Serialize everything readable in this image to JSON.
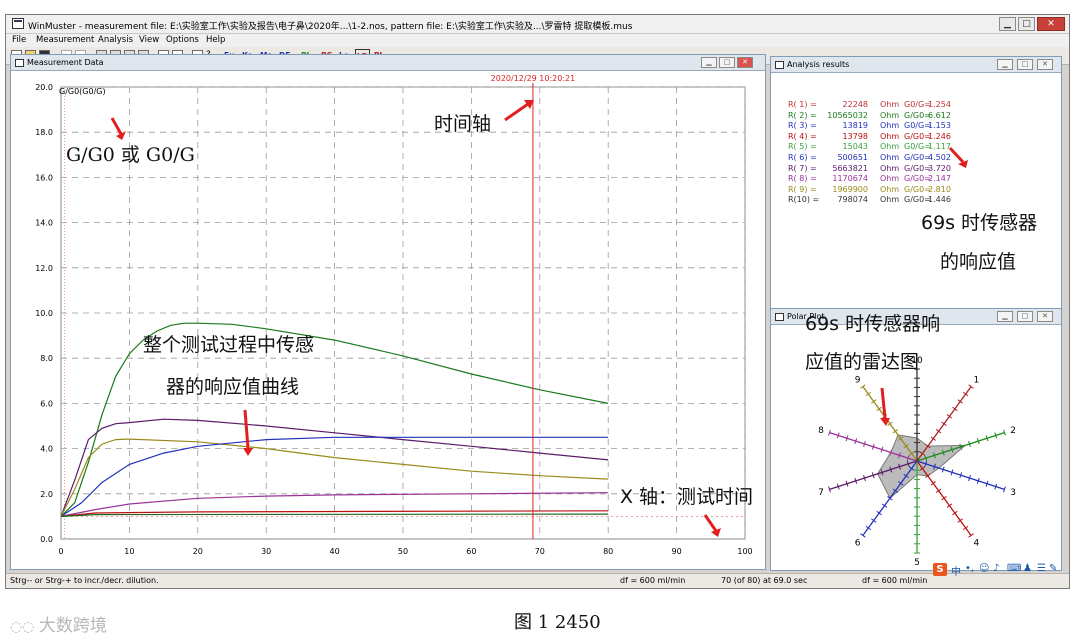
{
  "window": {
    "title": "WinMuster - measurement file: E:\\实验室工作\\实验及报告\\电子鼻\\2020年...\\1-2.nos, pattern file: E:\\实验室工作\\实验及...\\罗雷特 提取模板.mus",
    "min": "▁",
    "max": "□",
    "close": "✕"
  },
  "menu": [
    "File",
    "Measurement",
    "Analysis",
    "View",
    "Options",
    "Help"
  ],
  "toolbar": {
    "groups": [
      "Eu",
      "Ka",
      "Ma",
      "DF",
      "PL",
      "PC",
      "Lo",
      "LD",
      "PL"
    ]
  },
  "measurement": {
    "title": "Measurement Data",
    "time_marker": "2020/12/29 10:20:21",
    "legend_label": "G/G0(G0/G)"
  },
  "chart_data": {
    "type": "line",
    "title": "",
    "xlabel": "",
    "ylabel": "",
    "xlim": [
      0,
      100
    ],
    "ylim": [
      0,
      20
    ],
    "x_ticks": [
      "0",
      "10",
      "20",
      "30",
      "40",
      "50",
      "60",
      "70",
      "80",
      "90",
      "100"
    ],
    "y_ticks": [
      "0.0",
      "2.0",
      "4.0",
      "6.0",
      "8.0",
      "10.0",
      "12.0",
      "14.0",
      "16.0",
      "18.0",
      "20.0"
    ],
    "time_axis_x": 69,
    "series": [
      {
        "color": "#1a7a1a",
        "values": [
          [
            0,
            1
          ],
          [
            2,
            1.6
          ],
          [
            4,
            3.4
          ],
          [
            6,
            5.5
          ],
          [
            8,
            7.2
          ],
          [
            10,
            8.2
          ],
          [
            12,
            8.8
          ],
          [
            14,
            9.2
          ],
          [
            16,
            9.45
          ],
          [
            18,
            9.55
          ],
          [
            20,
            9.55
          ],
          [
            25,
            9.5
          ],
          [
            30,
            9.3
          ],
          [
            40,
            8.8
          ],
          [
            50,
            8.1
          ],
          [
            60,
            7.3
          ],
          [
            70,
            6.6
          ],
          [
            80,
            6.0
          ]
        ]
      },
      {
        "color": "#5a1a6a",
        "values": [
          [
            0,
            1
          ],
          [
            2,
            2.6
          ],
          [
            4,
            4.4
          ],
          [
            6,
            4.9
          ],
          [
            8,
            5.1
          ],
          [
            10,
            5.15
          ],
          [
            15,
            5.3
          ],
          [
            20,
            5.25
          ],
          [
            30,
            5.0
          ],
          [
            40,
            4.7
          ],
          [
            50,
            4.4
          ],
          [
            60,
            4.1
          ],
          [
            70,
            3.8
          ],
          [
            80,
            3.5
          ]
        ]
      },
      {
        "color": "#9a8a1a",
        "values": [
          [
            0,
            1
          ],
          [
            2,
            2.2
          ],
          [
            4,
            3.6
          ],
          [
            6,
            4.2
          ],
          [
            8,
            4.4
          ],
          [
            10,
            4.42
          ],
          [
            20,
            4.3
          ],
          [
            30,
            4.0
          ],
          [
            40,
            3.6
          ],
          [
            50,
            3.3
          ],
          [
            60,
            3.0
          ],
          [
            70,
            2.8
          ],
          [
            80,
            2.65
          ]
        ]
      },
      {
        "color": "#2233bb",
        "values": [
          [
            0,
            1
          ],
          [
            3,
            1.6
          ],
          [
            6,
            2.5
          ],
          [
            10,
            3.3
          ],
          [
            15,
            3.8
          ],
          [
            20,
            4.1
          ],
          [
            30,
            4.4
          ],
          [
            40,
            4.5
          ],
          [
            50,
            4.5
          ],
          [
            60,
            4.5
          ],
          [
            70,
            4.5
          ],
          [
            80,
            4.5
          ]
        ]
      },
      {
        "color": "#993399",
        "values": [
          [
            0,
            1
          ],
          [
            5,
            1.3
          ],
          [
            10,
            1.55
          ],
          [
            20,
            1.8
          ],
          [
            30,
            1.9
          ],
          [
            40,
            1.95
          ],
          [
            60,
            2.0
          ],
          [
            80,
            2.05
          ]
        ]
      },
      {
        "color": "#bb1111",
        "values": [
          [
            0,
            1
          ],
          [
            5,
            1.15
          ],
          [
            20,
            1.2
          ],
          [
            80,
            1.25
          ]
        ]
      },
      {
        "color": "#226622",
        "values": [
          [
            0,
            1
          ],
          [
            5,
            1.08
          ],
          [
            80,
            1.1
          ]
        ]
      }
    ]
  },
  "analysis": {
    "title": "Analysis results",
    "rows": [
      {
        "label": "R( 1) =",
        "ohm": "22248",
        "unit": "Ohm",
        "ratio": "G0/G=",
        "val": "1.254",
        "color": "#c03030"
      },
      {
        "label": "R( 2) =",
        "ohm": "10565032",
        "unit": "Ohm",
        "ratio": "G/G0=",
        "val": "6.612",
        "color": "#1a7a1a"
      },
      {
        "label": "R( 3) =",
        "ohm": "13819",
        "unit": "Ohm",
        "ratio": "G0/G=",
        "val": "1.153",
        "color": "#2233bb"
      },
      {
        "label": "R( 4) =",
        "ohm": "13798",
        "unit": "Ohm",
        "ratio": "G/G0=",
        "val": "1.246",
        "color": "#bb1111"
      },
      {
        "label": "R( 5) =",
        "ohm": "15043",
        "unit": "Ohm",
        "ratio": "G0/G=",
        "val": "1.117",
        "color": "#3aa03a"
      },
      {
        "label": "R( 6) =",
        "ohm": "500651",
        "unit": "Ohm",
        "ratio": "G/G0=",
        "val": "4.502",
        "color": "#2233bb"
      },
      {
        "label": "R( 7) =",
        "ohm": "5663821",
        "unit": "Ohm",
        "ratio": "G/G0=",
        "val": "3.720",
        "color": "#5a1a6a"
      },
      {
        "label": "R( 8) =",
        "ohm": "1170674",
        "unit": "Ohm",
        "ratio": "G/G0=",
        "val": "2.147",
        "color": "#993399"
      },
      {
        "label": "R( 9) =",
        "ohm": "1969900",
        "unit": "Ohm",
        "ratio": "G/G0=",
        "val": "2.810",
        "color": "#9a8a1a"
      },
      {
        "label": "R(10) =",
        "ohm": "798074",
        "unit": "Ohm",
        "ratio": "G/G0=",
        "val": "1.446",
        "color": "#333333"
      }
    ]
  },
  "polar": {
    "title": "Polar Plot",
    "axes": [
      "1",
      "2",
      "3",
      "4",
      "5",
      "6",
      "7",
      "8",
      "9",
      "10"
    ]
  },
  "status": {
    "hint": "Strg-- or Strg-+ to incr./decr. dilution.",
    "flow1": "df = 600 ml/min",
    "progress": "70 (of 80) at 69.0 sec",
    "flow2": "df = 600 ml/min"
  },
  "annotations": {
    "ratio": "G/G0 或 G0/G",
    "timeaxis": "时间轴",
    "curve1": "整个测试过程中传感",
    "curve2": "器的响应值曲线",
    "xaxis": "X 轴：测试时间",
    "resp1": "69s 时传感器",
    "resp2": "的响应值",
    "radar1": "69s 时传感器响",
    "radar2": "应值的雷达图"
  },
  "ime": {
    "logo": "S",
    "items": [
      "中",
      "•,",
      "☺",
      "♪",
      "⌨",
      "♟",
      "☰",
      "✎"
    ]
  },
  "caption": "图 1 2450",
  "watermark": "大数跨境"
}
